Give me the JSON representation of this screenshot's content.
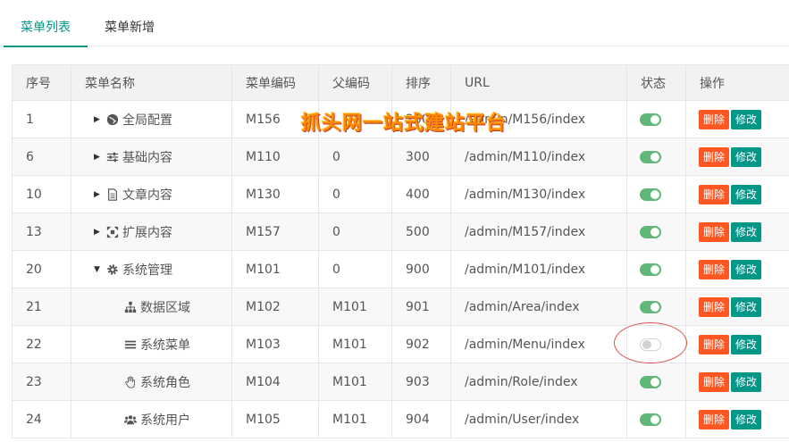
{
  "tabs": [
    {
      "label": "菜单列表"
    },
    {
      "label": "菜单新增"
    }
  ],
  "table": {
    "headers": {
      "id": "序号",
      "name": "菜单名称",
      "code": "菜单编码",
      "parent": "父编码",
      "sort": "排序",
      "url": "URL",
      "status": "状态",
      "ops": "操作"
    },
    "rows": [
      {
        "id": "1",
        "name": "全局配置",
        "code": "M156",
        "parent": "",
        "sort": "200",
        "url": "/admin/M156/index",
        "status": "on",
        "icon": "globe-icon",
        "level": 0,
        "arrow": "right"
      },
      {
        "id": "6",
        "name": "基础内容",
        "code": "M110",
        "parent": "0",
        "sort": "300",
        "url": "/admin/M110/index",
        "status": "on",
        "icon": "sliders-icon",
        "level": 0,
        "arrow": "right"
      },
      {
        "id": "10",
        "name": "文章内容",
        "code": "M130",
        "parent": "0",
        "sort": "400",
        "url": "/admin/M130/index",
        "status": "on",
        "icon": "document-icon",
        "level": 0,
        "arrow": "right"
      },
      {
        "id": "13",
        "name": "扩展内容",
        "code": "M157",
        "parent": "0",
        "sort": "500",
        "url": "/admin/M157/index",
        "status": "on",
        "icon": "expand-icon",
        "level": 0,
        "arrow": "right"
      },
      {
        "id": "20",
        "name": "系统管理",
        "code": "M101",
        "parent": "0",
        "sort": "900",
        "url": "/admin/M101/index",
        "status": "on",
        "icon": "gear-icon",
        "level": 0,
        "arrow": "down"
      },
      {
        "id": "21",
        "name": "数据区域",
        "code": "M102",
        "parent": "M101",
        "sort": "901",
        "url": "/admin/Area/index",
        "status": "on",
        "icon": "sitemap-icon",
        "level": 1,
        "arrow": "none"
      },
      {
        "id": "22",
        "name": "系统菜单",
        "code": "M103",
        "parent": "M101",
        "sort": "902",
        "url": "/admin/Menu/index",
        "status": "off",
        "icon": "menu-icon",
        "level": 1,
        "arrow": "none"
      },
      {
        "id": "23",
        "name": "系统角色",
        "code": "M104",
        "parent": "M101",
        "sort": "903",
        "url": "/admin/Role/index",
        "status": "on",
        "icon": "hand-icon",
        "level": 1,
        "arrow": "none"
      },
      {
        "id": "24",
        "name": "系统用户",
        "code": "M105",
        "parent": "M101",
        "sort": "904",
        "url": "/admin/User/index",
        "status": "on",
        "icon": "users-icon",
        "level": 1,
        "arrow": "none"
      }
    ],
    "buttons": {
      "delete": "删除",
      "edit": "修改"
    }
  },
  "watermark": "抓头网一站式建站平台",
  "colors": {
    "accent": "#009688",
    "danger": "#ff5722",
    "switch_on": "#5fb878"
  }
}
